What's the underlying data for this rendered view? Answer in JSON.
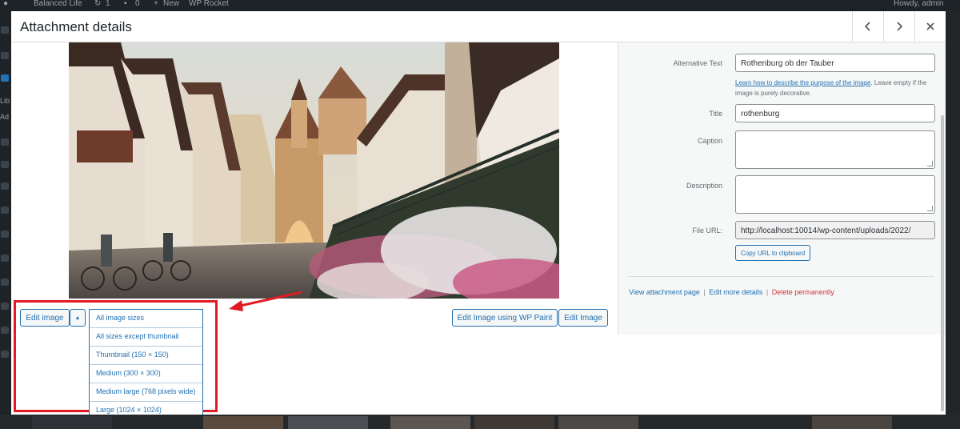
{
  "adminbar": {
    "site_name": "Balanced Life",
    "updates_count": "1",
    "comments_count": "0",
    "new_label": "New",
    "plugin_label": "WP Rocket",
    "greeting": "Howdy, admin"
  },
  "sidebar_fragments": [
    "Lib",
    "Ad"
  ],
  "modal": {
    "title": "Attachment details",
    "prev_icon": "chevron-left-icon",
    "next_icon": "chevron-right-icon",
    "close_icon": "close-icon"
  },
  "image_area": {
    "image_description": "photo",
    "edit_image_label": "Edit image",
    "dropdown_toggle_icon": "triangle-up-icon",
    "size_options": [
      "All image sizes",
      "All sizes except thumbnail",
      "Thumbnail (150 × 150)",
      "Medium (300 × 300)",
      "Medium large (768 pixels wide)",
      "Large (1024 × 1024)"
    ],
    "wp_paint_label": "Edit Image using WP Paint",
    "edit_image_right_label": "Edit Image"
  },
  "details": {
    "alt_label": "Alternative Text",
    "alt_value": "Rothenburg ob der Tauber",
    "alt_help_link": "Learn how to describe the purpose of the image",
    "alt_help_text": ". Leave empty if the image is purely decorative.",
    "title_label": "Title",
    "title_value": "rothenburg",
    "caption_label": "Caption",
    "caption_value": "",
    "description_label": "Description",
    "description_value": "",
    "file_url_label": "File URL:",
    "file_url_value": "http://localhost:10014/wp-content/uploads/2022/",
    "copy_url_label": "Copy URL to clipboard",
    "view_link": "View attachment page",
    "edit_link": "Edit more details",
    "delete_link": "Delete permanently",
    "separator": "|"
  },
  "colors": {
    "accent": "#2271b1",
    "danger": "#d63638",
    "highlight": "#e01b24",
    "overlay": "#1d2327"
  }
}
